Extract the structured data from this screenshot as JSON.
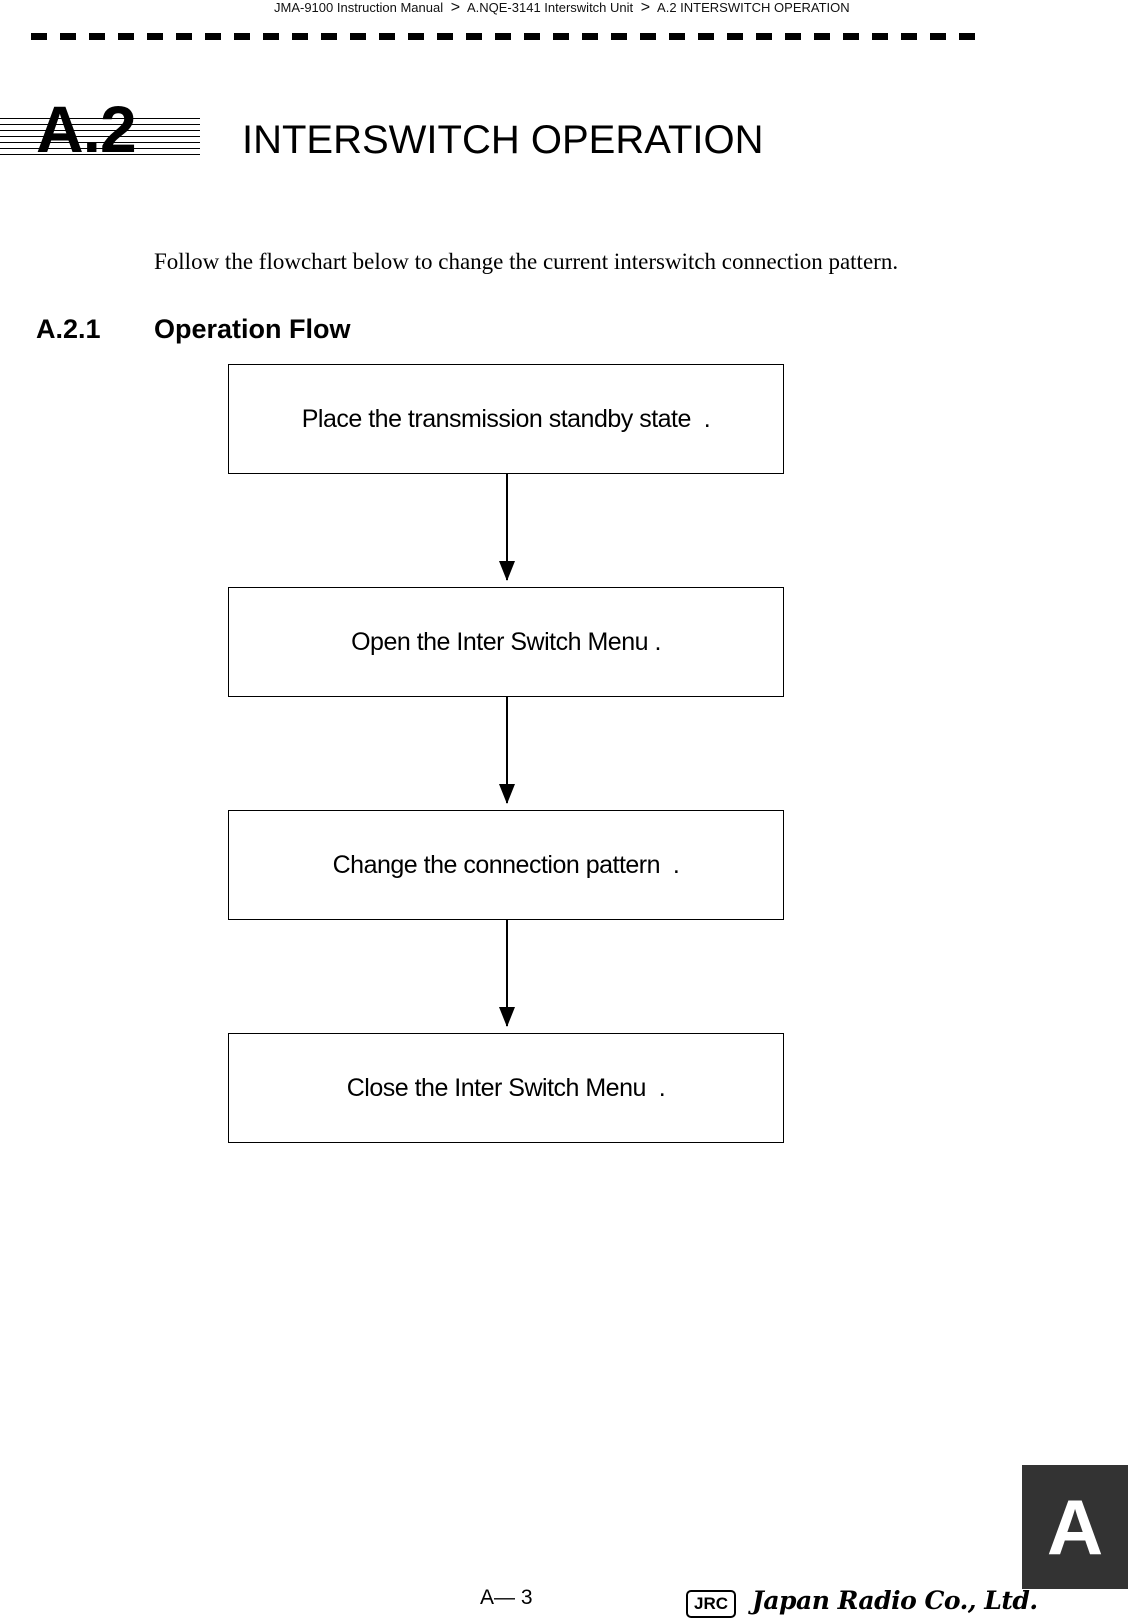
{
  "header": {
    "breadcrumb": [
      "JMA-9100 Instruction Manual",
      "A.NQE-3141 Interswitch Unit",
      "A.2  INTERSWITCH OPERATION"
    ],
    "separator": ">"
  },
  "chapter": {
    "number": "A.2",
    "title": "INTERSWITCH OPERATION"
  },
  "intro": "Follow the flowchart below to change the current interswitch connection pattern.",
  "section": {
    "number": "A.2.1",
    "title": "Operation Flow"
  },
  "flowchart": {
    "steps": [
      "Place the transmission standby state  .",
      "Open the Inter Switch Menu .",
      "Change the connection pattern  .",
      "Close the Inter Switch Menu  ."
    ]
  },
  "footer": {
    "page_number": "A— 3",
    "logo_badge": "JRC",
    "company": "Japan Radio Co., Ltd.",
    "tab_letter": "A"
  }
}
